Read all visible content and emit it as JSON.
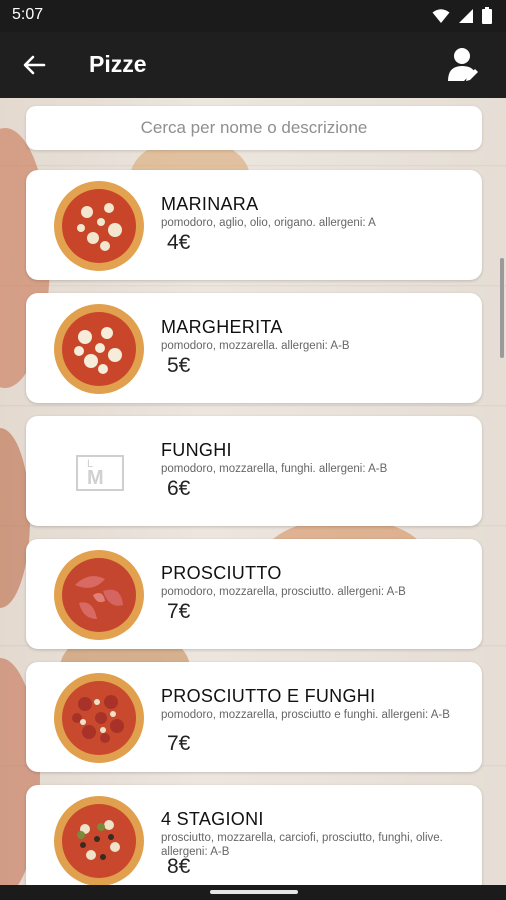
{
  "status_bar": {
    "time": "5:07"
  },
  "app_bar": {
    "title": "Pizze"
  },
  "search": {
    "placeholder": "Cerca per nome o descrizione"
  },
  "logo_letters": {
    "top": "L",
    "main": "M"
  },
  "items": [
    {
      "name": "MARINARA",
      "description": "pomodoro, aglio, olio, origano. allergeni: A",
      "price": "4€",
      "image": "pizza-marinara-image"
    },
    {
      "name": "MARGHERITA",
      "description": "pomodoro, mozzarella. allergeni: A-B",
      "price": "5€",
      "image": "pizza-margherita-image"
    },
    {
      "name": "FUNGHI",
      "description": "pomodoro, mozzarella, funghi. allergeni: A-B",
      "price": "6€",
      "image": "placeholder-logo-image"
    },
    {
      "name": "PROSCIUTTO",
      "description": "pomodoro, mozzarella, prosciutto. allergeni: A-B",
      "price": "7€",
      "image": "pizza-prosciutto-image"
    },
    {
      "name": "PROSCIUTTO E FUNGHI",
      "description": "pomodoro, mozzarella, prosciutto e funghi. allergeni: A-B",
      "price": "7€",
      "image": "pizza-prosciutto-funghi-image"
    },
    {
      "name": "4 STAGIONI",
      "description": "prosciutto, mozzarella, carciofi, prosciutto, funghi, olive. allergeni: A-B",
      "price": "8€",
      "image": "pizza-4-stagioni-image"
    }
  ],
  "colors": {
    "app_bar": "#1f1f1f",
    "card": "#ffffff",
    "background": "#e9e3dc"
  }
}
